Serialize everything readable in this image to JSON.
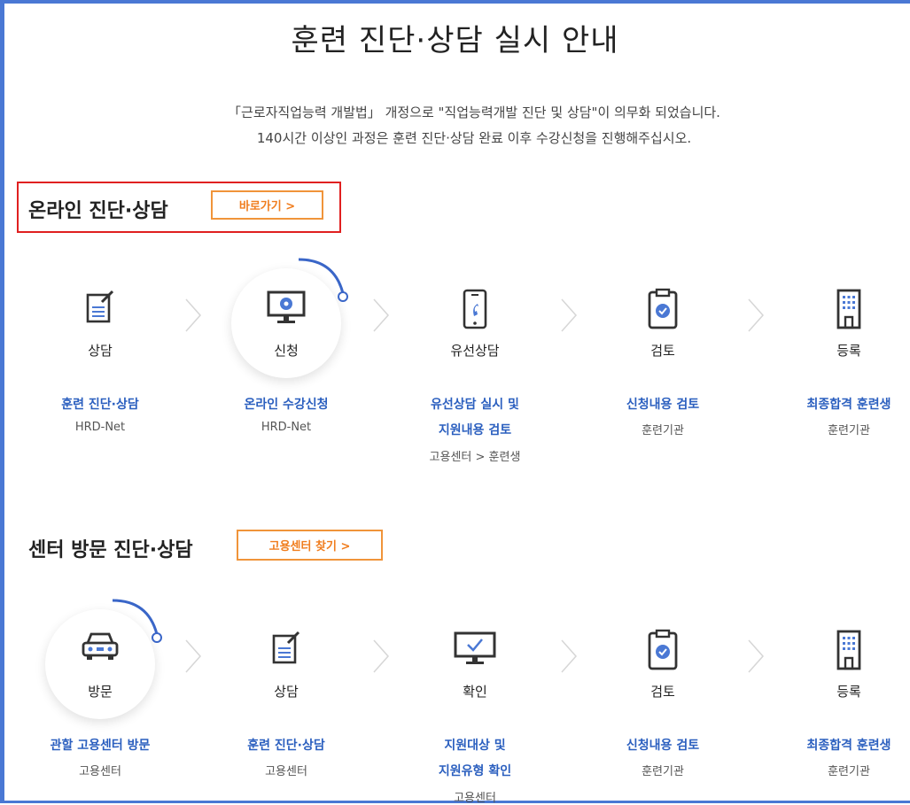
{
  "title": "훈련 진단·상담 실시 안내",
  "notice": {
    "line1": "「근로자직업능력 개발법」 개정으로 \"직업능력개발 진단 및 상담\"이 의무화 되었습니다.",
    "line2": "140시간 이상인 과정은 훈련 진단·상담 완료 이후 수강신청을 진행해주십시오."
  },
  "online": {
    "title": "온라인 진단·상담",
    "button": "바로가기 >",
    "steps": [
      {
        "icon": "document-pen-icon",
        "label": "상담",
        "desc": [
          "훈련 진단·상담"
        ],
        "sub": "HRD-Net"
      },
      {
        "icon": "monitor-icon",
        "label": "신청",
        "desc": [
          "온라인 수강신청"
        ],
        "sub": "HRD-Net"
      },
      {
        "icon": "phone-icon",
        "label": "유선상담",
        "desc": [
          "유선상담 실시 및",
          "지원내용 검토"
        ],
        "sub": "고용센터 > 훈련생"
      },
      {
        "icon": "clipboard-check-icon",
        "label": "검토",
        "desc": [
          "신청내용 검토"
        ],
        "sub": "훈련기관"
      },
      {
        "icon": "building-icon",
        "label": "등록",
        "desc": [
          "최종합격 훈련생"
        ],
        "sub": "훈련기관"
      }
    ]
  },
  "center": {
    "title": "센터 방문 진단·상담",
    "button": "고용센터 찾기 >",
    "steps": [
      {
        "icon": "car-icon",
        "label": "방문",
        "desc": [
          "관할 고용센터 방문"
        ],
        "sub": "고용센터"
      },
      {
        "icon": "document-pen-icon",
        "label": "상담",
        "desc": [
          "훈련 진단·상담"
        ],
        "sub": "고용센터"
      },
      {
        "icon": "monitor-check-icon",
        "label": "확인",
        "desc": [
          "지원대상 및",
          "지원유형 확인"
        ],
        "sub": "고용센터"
      },
      {
        "icon": "clipboard-check-icon",
        "label": "검토",
        "desc": [
          "신청내용 검토"
        ],
        "sub": "훈련기관"
      },
      {
        "icon": "building-icon",
        "label": "등록",
        "desc": [
          "최종합격 훈련생"
        ],
        "sub": "훈련기관"
      }
    ]
  },
  "colors": {
    "accent_blue": "#2b5fbf",
    "button_orange": "#f07d1e",
    "highlight_red": "#e02020",
    "frame_blue": "#4a78d4"
  }
}
